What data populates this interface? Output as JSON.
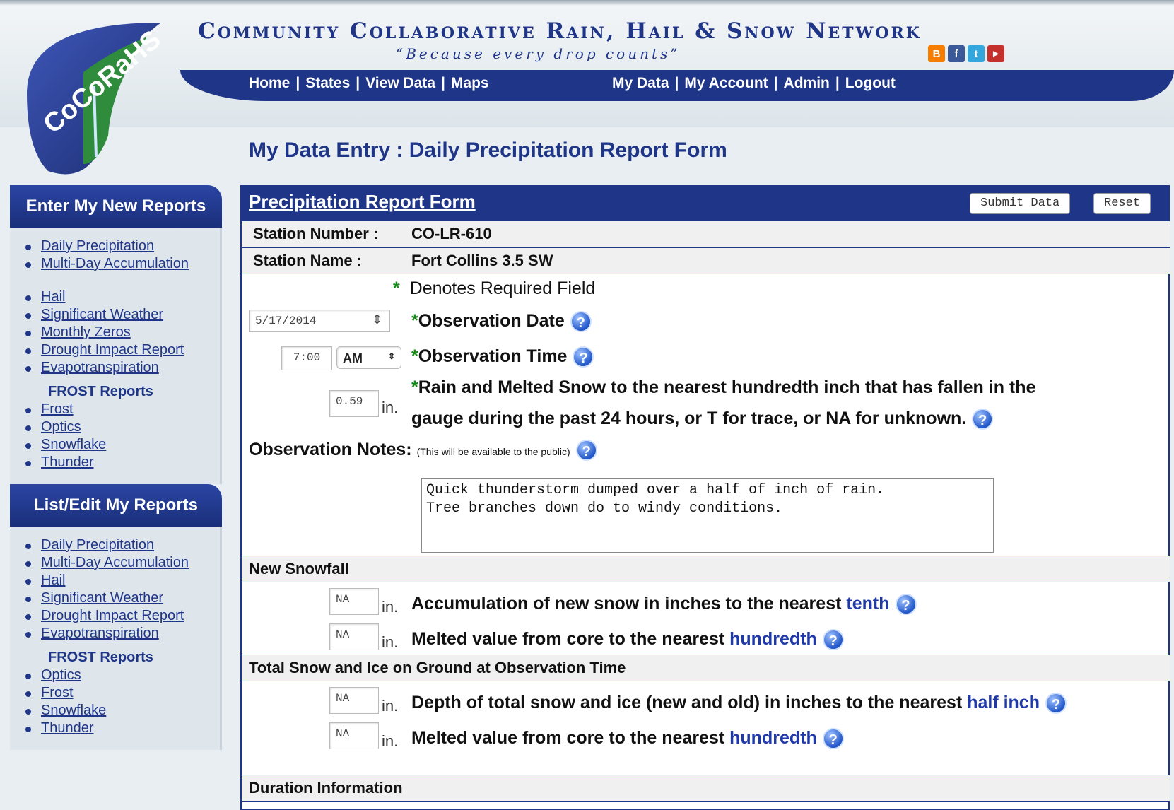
{
  "header": {
    "logo_text": "CoCoRaHS",
    "title": "Community Collaborative Rain, Hail & Snow Network",
    "tagline": "“Because every drop counts”",
    "social_icons": [
      "blogger-icon",
      "facebook-icon",
      "twitter-icon",
      "youtube-icon"
    ],
    "nav_left": [
      "Home",
      "States",
      "View Data",
      "Maps"
    ],
    "nav_right": [
      "My Data",
      "My Account",
      "Admin",
      "Logout"
    ],
    "separator": "|"
  },
  "page_title": "My Data Entry : Daily Precipitation Report Form",
  "sidebar": {
    "new_reports": {
      "title": "Enter My New Reports",
      "items": [
        "Daily Precipitation",
        "Multi-Day Accumulation",
        "Hail",
        "Significant Weather",
        "Monthly Zeros",
        "Drought Impact Report",
        "Evapotranspiration"
      ],
      "frost_title": "FROST Reports",
      "frost_items": [
        "Frost",
        "Optics",
        "Snowflake",
        "Thunder"
      ]
    },
    "edit_reports": {
      "title": "List/Edit My Reports",
      "items": [
        "Daily Precipitation",
        "Multi-Day Accumulation",
        "Hail",
        "Significant Weather",
        "Drought Impact Report",
        "Evapotranspiration"
      ],
      "frost_title": "FROST Reports",
      "frost_items": [
        "Optics",
        "Frost",
        "Snowflake",
        "Thunder"
      ]
    }
  },
  "form": {
    "title": "Precipitation Report Form",
    "submit_label": "Submit Data",
    "reset_label": "Reset",
    "station_number_label": "Station Number :",
    "station_number": "CO-LR-610",
    "station_name_label": "Station Name :",
    "station_name": "Fort Collins 3.5 SW",
    "required_star": "*",
    "required_note": "Denotes Required Field",
    "obs_date_value": "5/17/2014",
    "obs_date_label": "Observation Date",
    "obs_time_value": "7:00",
    "obs_ampm": "AM",
    "obs_time_label": "Observation Time",
    "rain_value": "0.59",
    "unit": "in.",
    "rain_label_line1": "Rain and Melted Snow to the nearest hundredth inch that has fallen in the",
    "rain_label_line2": "gauge during the past 24 hours, or T for trace, or NA for unknown.",
    "notes_label": "Observation Notes:",
    "notes_hint": "(This will be available to the public)",
    "notes_value": "Quick thunderstorm dumped over a half of inch of rain.\nTree branches down do to windy conditions.",
    "new_snowfall_header": "New Snowfall",
    "new_snow_value": "NA",
    "new_snow_label": "Accumulation of new snow in inches to the nearest",
    "new_snow_emph": "tenth",
    "new_snow_melt_value": "NA",
    "melted_label": "Melted value from core to the nearest",
    "melted_emph": "hundredth",
    "total_snow_header": "Total Snow and Ice on Ground at Observation Time",
    "depth_value": "NA",
    "depth_label": "Depth of total snow and ice (new and old) in inches to the nearest",
    "depth_emph": "half inch",
    "total_melt_value": "NA",
    "duration_header": "Duration Information"
  },
  "colors": {
    "brand": "#1f3688",
    "required": "#1a8a1a",
    "link": "#1f3aa8"
  }
}
